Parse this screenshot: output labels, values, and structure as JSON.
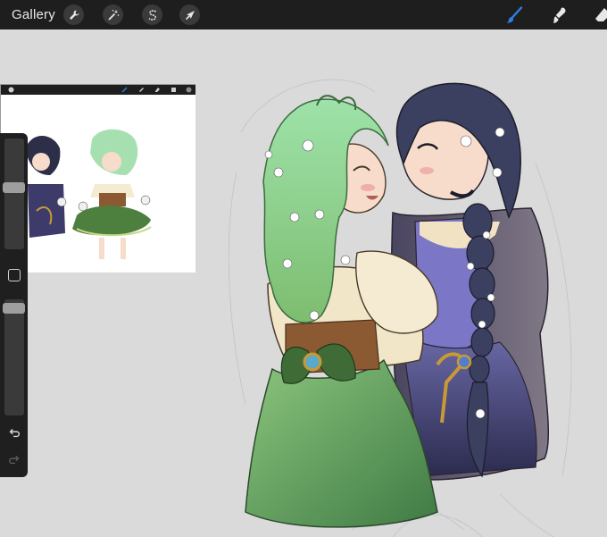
{
  "app": {
    "gallery_label": "Gallery"
  },
  "toolbar": {
    "left_tools": [
      {
        "name": "actions",
        "icon": "wrench-icon"
      },
      {
        "name": "adjustments",
        "icon": "magic-wand-icon"
      },
      {
        "name": "selection",
        "icon": "selection-s-icon"
      },
      {
        "name": "transform",
        "icon": "arrow-cursor-icon"
      }
    ],
    "right_tools": [
      {
        "name": "brush",
        "icon": "brush-icon",
        "active": true
      },
      {
        "name": "smudge",
        "icon": "smudge-icon"
      },
      {
        "name": "eraser",
        "icon": "eraser-icon"
      }
    ]
  },
  "sidebar": {
    "brush_size_level": 0.45,
    "opacity_level": 0.93
  },
  "colors": {
    "toolbar_bg": "#1e1e1e",
    "canvas_bg": "#dadada",
    "active_brush": "#2f7fe6",
    "green_hair": "#8fd48a",
    "dark_hair": "#3a3f5c",
    "green_skirt": "#5e9b57",
    "purple_dress": "#6a63a8"
  }
}
